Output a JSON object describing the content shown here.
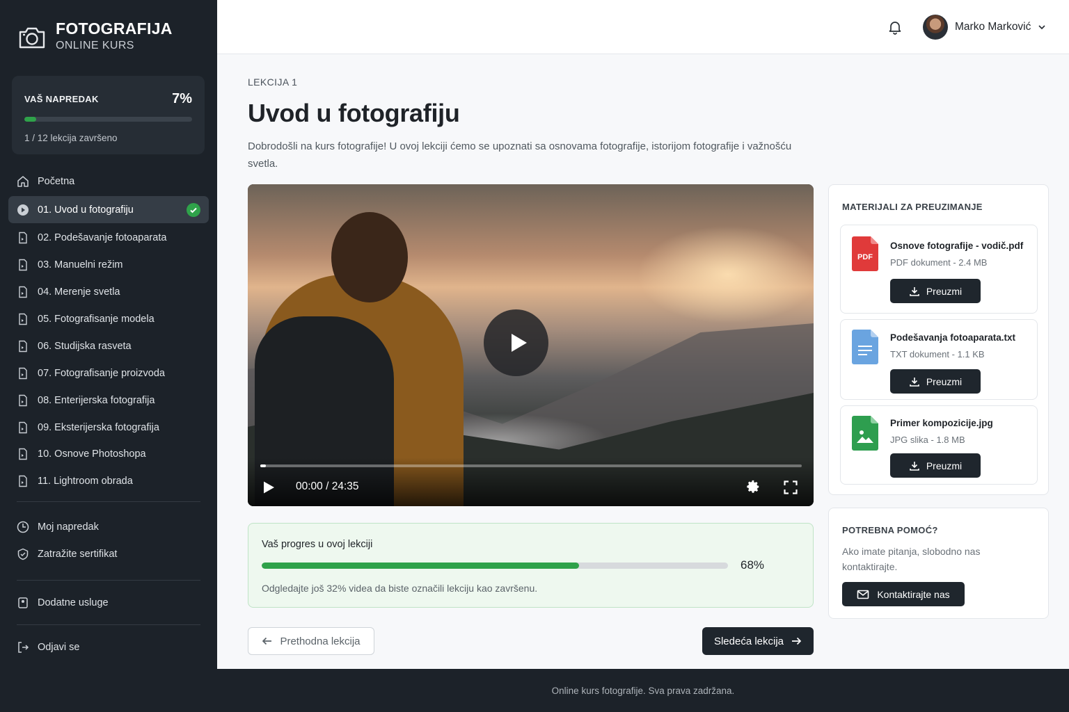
{
  "brand": {
    "title": "FOTOGRAFIJA",
    "subtitle": "ONLINE KURS"
  },
  "progress": {
    "label": "VAŠ NAPREDAK",
    "percent_text": "7%",
    "percent": 7,
    "summary": "1 / 12 lekcija završeno"
  },
  "nav": {
    "home": "Početna",
    "lessons": [
      {
        "label": "01. Uvod u fotografiju",
        "active": true,
        "completed": true
      },
      {
        "label": "02. Podešavanje fotoaparata"
      },
      {
        "label": "03. Manuelni režim"
      },
      {
        "label": "04. Merenje svetla"
      },
      {
        "label": "05. Fotografisanje modela"
      },
      {
        "label": "06. Studijska rasveta"
      },
      {
        "label": "07. Fotografisanje proizvoda"
      },
      {
        "label": "08. Enterijerska fotografija"
      },
      {
        "label": "09. Eksterijerska fotografija"
      },
      {
        "label": "10. Osnove Photoshopa"
      },
      {
        "label": "11. Lightroom obrada"
      }
    ],
    "my_progress": "Moj napredak",
    "certificate": "Zatražite sertifikat",
    "extra_services": "Dodatne usluge",
    "logout": "Odjavi se"
  },
  "header": {
    "user_name": "Marko Marković"
  },
  "lesson": {
    "kicker": "LEKCIJA 1",
    "title": "Uvod u fotografiju",
    "description": "Dobrodošli na kurs fotografije! U ovoj lekciji ćemo se upoznati sa osnovama fotografije, istorijom fotografije i važnošću svetla."
  },
  "video": {
    "time": "00:00 / 24:35",
    "played_fraction": 0
  },
  "lesson_progress": {
    "title": "Vaš progres u ovoj lekciji",
    "percent_text": "68%",
    "percent": 68,
    "note": "Odgledajte još 32% videa da biste označili lekciju kao završenu."
  },
  "navigation": {
    "prev": "Prethodna lekcija",
    "next": "Sledeća lekcija"
  },
  "materials": {
    "title": "MATERIJALI ZA PREUZIMANJE",
    "files": [
      {
        "name": "Osnove fotografije - vodič.pdf",
        "meta": "PDF dokument - 2.4 MB",
        "icon": "pdf-file-icon",
        "badge": "PDF",
        "color": "#e03a3a"
      },
      {
        "name": "Podešavanja fotoaparata.txt",
        "meta": "TXT dokument - 1.1 KB",
        "icon": "txt-file-icon",
        "color": "#6aa4e0"
      },
      {
        "name": "Primer kompozicije.jpg",
        "meta": "JPG slika - 1.8 MB",
        "icon": "image-file-icon",
        "color": "#2e9e4f"
      }
    ],
    "download_label": "Preuzmi"
  },
  "help": {
    "title": "POTREBNA POMOĆ?",
    "text": "Ako imate pitanja, slobodno nas kontaktirajte.",
    "button": "Kontaktirajte nas"
  },
  "footer": {
    "text": "Online kurs fotografije. Sva prava zadržana."
  },
  "colors": {
    "accent_green": "#2fa24a",
    "sidebar_bg": "#1c2229",
    "button_dark": "#1f262d"
  }
}
